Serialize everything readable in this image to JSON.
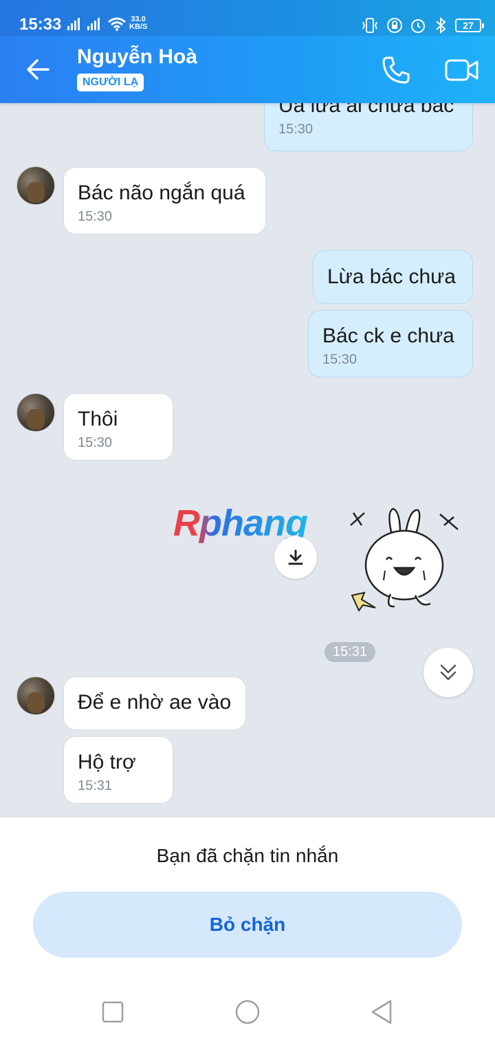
{
  "status": {
    "time": "15:33",
    "net_speed_value": "33.0",
    "net_speed_unit": "KB/S",
    "battery": "27"
  },
  "header": {
    "contact_name": "Nguyễn Hoà",
    "badge": "NGƯỜI LẠ",
    "back_icon": "arrow-left-icon",
    "call_icon": "phone-icon",
    "video_icon": "video-camera-icon"
  },
  "messages": [
    {
      "side": "out",
      "text": "Ủa lừa ai chưa bác",
      "time": "15:30"
    },
    {
      "side": "in",
      "text": "Bác não ngắn quá",
      "time": "15:30"
    },
    {
      "side": "out",
      "text": "Lừa bác chưa",
      "time": ""
    },
    {
      "side": "out",
      "text": "Bác ck e chưa",
      "time": "15:30"
    },
    {
      "side": "in",
      "text": "Thôi",
      "time": "15:30"
    },
    {
      "side": "out",
      "type": "sticker",
      "time": "15:31"
    },
    {
      "side": "in",
      "text": "Để e nhờ ae vào",
      "time": ""
    },
    {
      "side": "in",
      "text": "Hộ trợ",
      "time": "15:31"
    }
  ],
  "watermark": "Rphang",
  "blocked": {
    "message": "Bạn đã chặn tin nhắn",
    "unblock_label": "Bỏ chặn"
  },
  "nav": {
    "recent": "square-icon",
    "home": "circle-icon",
    "back": "triangle-back-icon"
  },
  "colors": {
    "header_start": "#2a7ff3",
    "header_end": "#1fb2f8",
    "out_bubble": "#d5eefd",
    "in_bubble": "#ffffff",
    "accent": "#1565d8"
  }
}
